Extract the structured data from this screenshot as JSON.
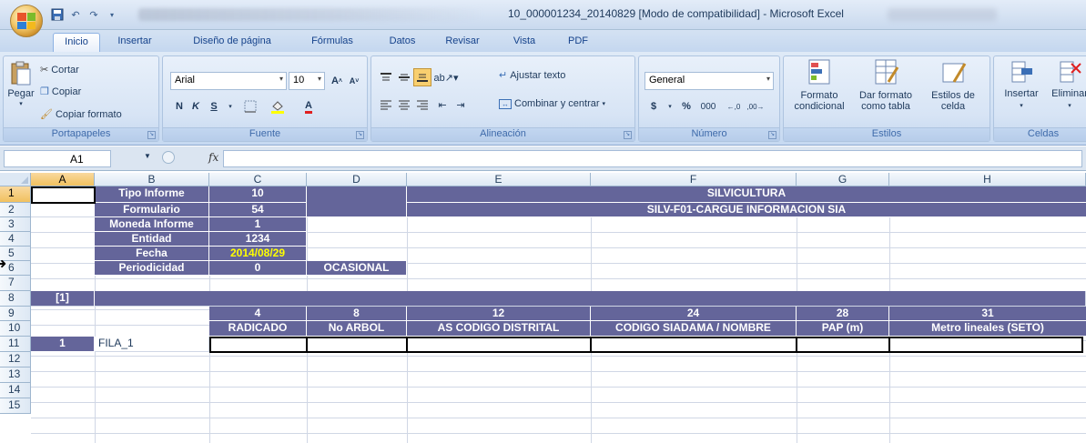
{
  "window": {
    "title": "10_000001234_20140829  [Modo de compatibilidad] - Microsoft Excel"
  },
  "tabs": [
    "Inicio",
    "Insertar",
    "Diseño de página",
    "Fórmulas",
    "Datos",
    "Revisar",
    "Vista",
    "PDF"
  ],
  "ribbon": {
    "portapapeles": {
      "label": "Portapapeles",
      "paste": "Pegar",
      "cut": "Cortar",
      "copy": "Copiar",
      "format_painter": "Copiar formato"
    },
    "fuente": {
      "label": "Fuente",
      "font_name": "Arial",
      "font_size": "10",
      "bold": "N",
      "italic": "K",
      "underline": "S"
    },
    "alineacion": {
      "label": "Alineación",
      "wrap_text": "Ajustar texto",
      "merge_center": "Combinar y centrar"
    },
    "numero": {
      "label": "Número",
      "format": "General",
      "currency": "$",
      "percent": "%",
      "thousands": "000"
    },
    "estilos": {
      "label": "Estilos",
      "conditional": "Formato condicional",
      "as_table": "Dar formato como tabla",
      "cell_styles": "Estilos de celda"
    },
    "celdas": {
      "label": "Celdas",
      "insert": "Insertar",
      "delete": "Eliminar"
    }
  },
  "formula_bar": {
    "name_box": "A1",
    "fx": "fx",
    "content": ""
  },
  "columns": [
    "A",
    "B",
    "C",
    "D",
    "E",
    "F",
    "G",
    "H"
  ],
  "rows": [
    "1",
    "2",
    "3",
    "4",
    "5",
    "6",
    "7",
    "8",
    "9",
    "10",
    "11",
    "12",
    "13",
    "14",
    "15"
  ],
  "sheet": {
    "params": [
      {
        "label": "Tipo Informe",
        "value": "10"
      },
      {
        "label": "Formulario",
        "value": "54"
      },
      {
        "label": "Moneda Informe",
        "value": "1"
      },
      {
        "label": "Entidad",
        "value": "1234"
      },
      {
        "label": "Fecha",
        "value": "2014/08/29"
      },
      {
        "label": "Periodicidad",
        "value": "0"
      }
    ],
    "periodicity_text": "OCASIONAL",
    "title_1": "SILVICULTURA",
    "title_2": "SILV-F01-CARGUE INFORMACION SIA",
    "section": "[1]",
    "col_codes": [
      "4",
      "8",
      "12",
      "24",
      "28",
      "31"
    ],
    "col_names": [
      "RADICADO",
      "No ARBOL",
      "AS CODIGO DISTRITAL",
      "CODIGO SIADAMA / NOMBRE",
      "PAP (m)",
      "Metro lineales (SETO)"
    ],
    "row11_num": "1",
    "row11_label": "FILA_1"
  }
}
